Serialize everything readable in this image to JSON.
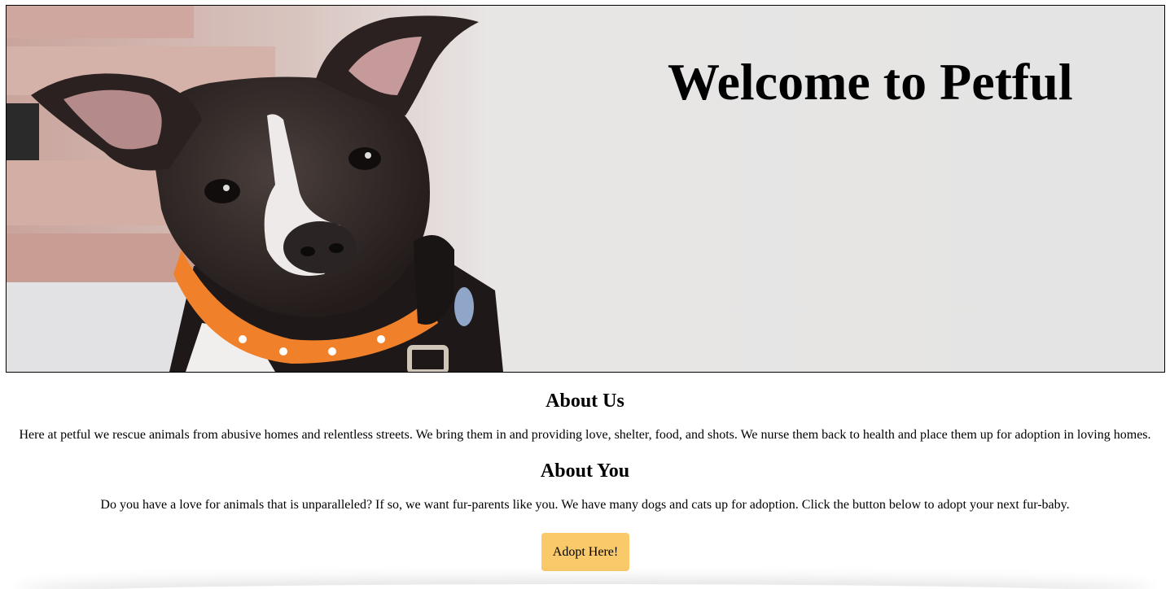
{
  "hero": {
    "title": "Welcome to Petful",
    "image_subject": "dog-photo"
  },
  "about_us": {
    "heading": "About Us",
    "text": "Here at petful we rescue animals from abusive homes and relentless streets. We bring them in and providing love, shelter, food, and shots. We nurse them back to health and place them up for adoption in loving homes."
  },
  "about_you": {
    "heading": "About You",
    "text": "Do you have a love for animals that is unparalleled? If so, we want fur-parents like you. We have many dogs and cats up for adoption. Click the button below to adopt your next fur-baby."
  },
  "cta": {
    "label": "Adopt Here!"
  },
  "colors": {
    "button": "#f9c96a",
    "collar": "#f0812a"
  }
}
